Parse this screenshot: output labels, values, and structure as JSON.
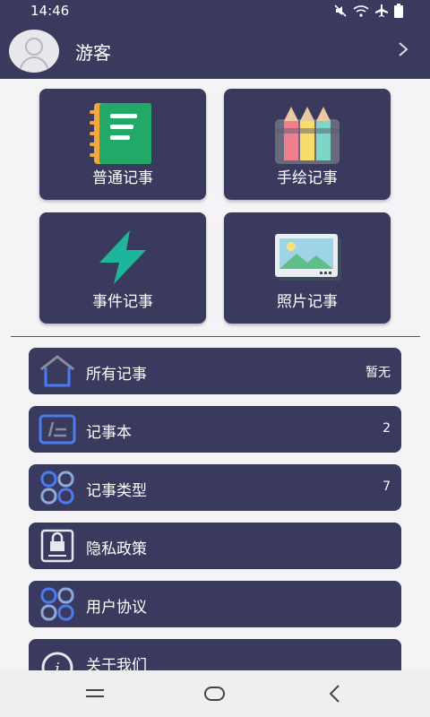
{
  "status_bar": {
    "time": "14:46",
    "icons": [
      "mute-icon",
      "wifi-icon",
      "airplane-icon",
      "battery-icon"
    ]
  },
  "header": {
    "username": "游客"
  },
  "quick_actions": [
    {
      "label": "普通记事",
      "icon": "notebook-icon"
    },
    {
      "label": "手绘记事",
      "icon": "pencils-icon"
    },
    {
      "label": "事件记事",
      "icon": "lightning-icon"
    },
    {
      "label": "照片记事",
      "icon": "photo-icon"
    }
  ],
  "menu": [
    {
      "label": "所有记事",
      "value": "暂无",
      "icon": "home-icon"
    },
    {
      "label": "记事本",
      "value": "2",
      "icon": "notepad-icon"
    },
    {
      "label": "记事类型",
      "value": "7",
      "icon": "category-icon"
    },
    {
      "label": "隐私政策",
      "value": "",
      "icon": "lock-icon"
    },
    {
      "label": "用户协议",
      "value": "",
      "icon": "category-icon"
    },
    {
      "label": "关于我们",
      "value": "",
      "icon": "info-icon"
    }
  ],
  "colors": {
    "header_bg": "#3a3a5e",
    "card_bg": "#3a3a5e",
    "page_bg": "#f4f4f6",
    "icon_blue": "#4a7bf0"
  }
}
